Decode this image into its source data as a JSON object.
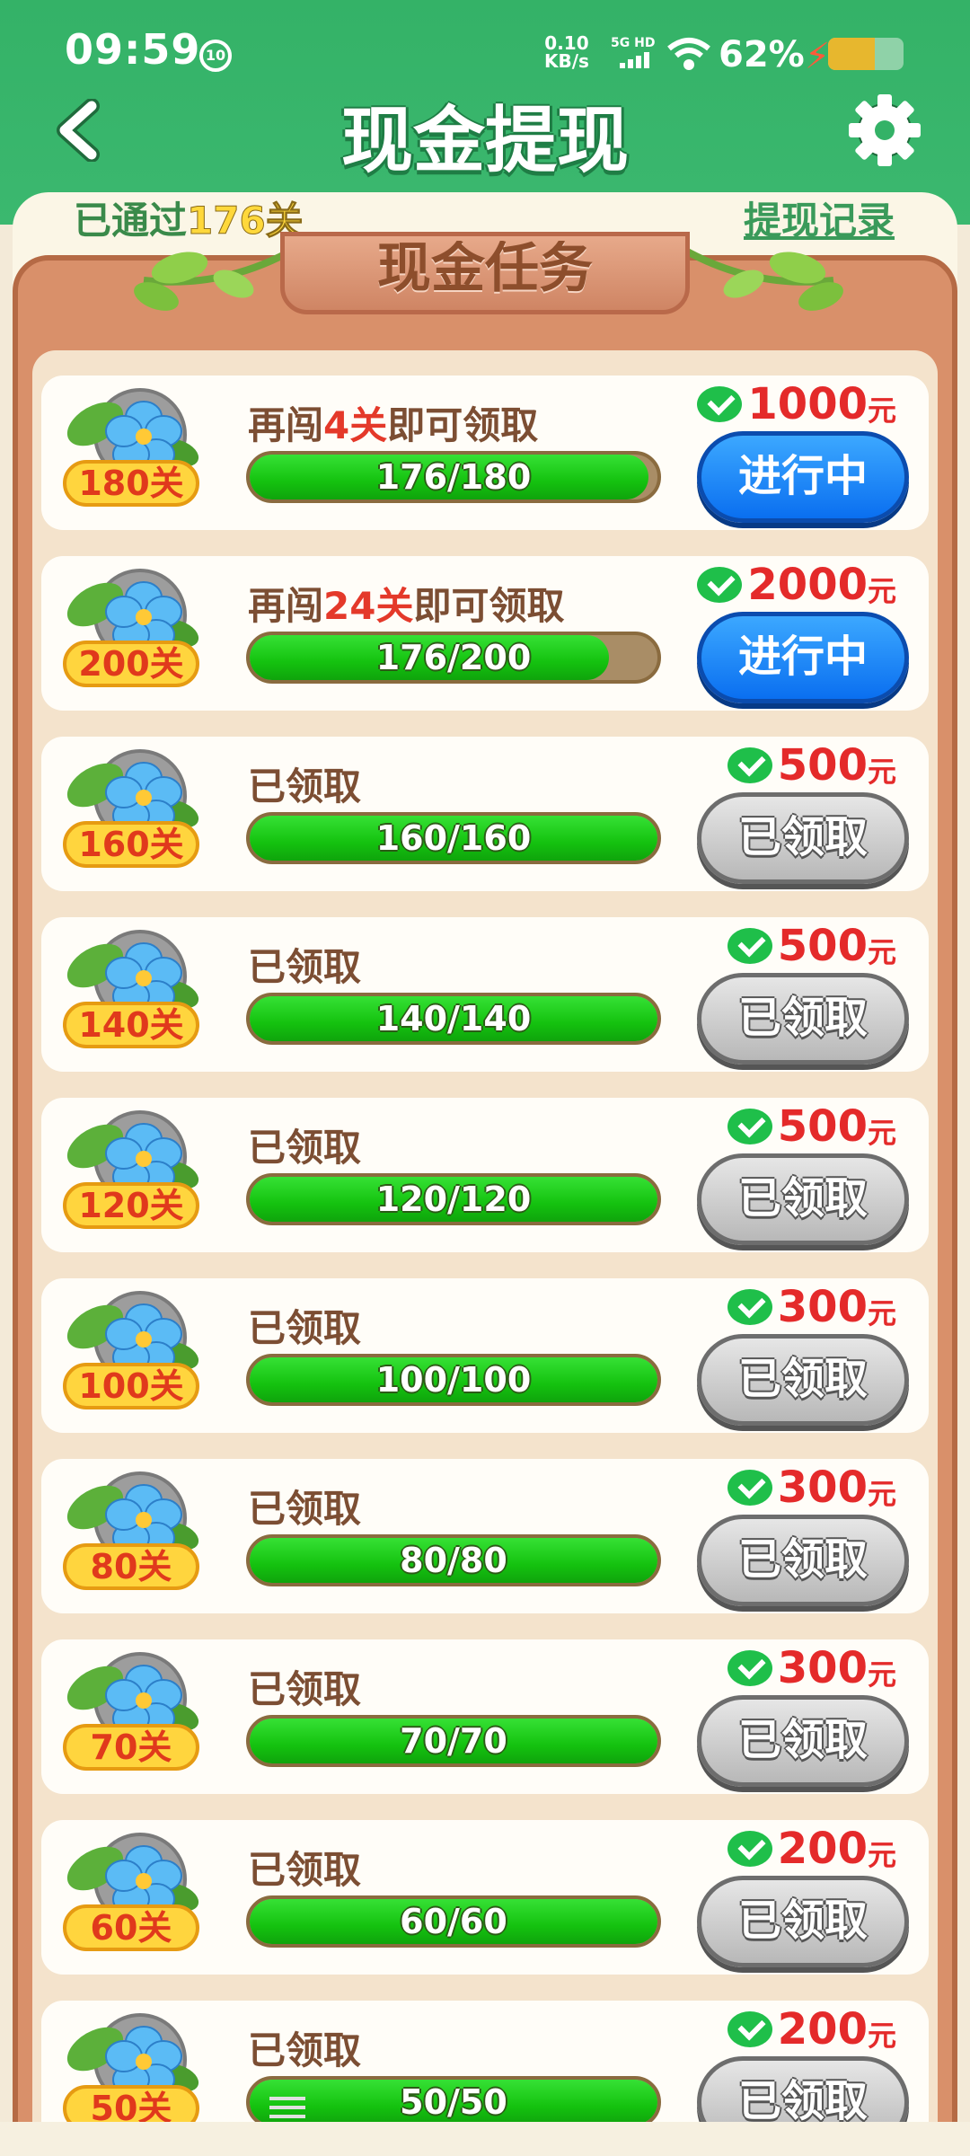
{
  "status_bar": {
    "time": "09:59",
    "notification_badge": "10",
    "net_speed_value": "0.10",
    "net_speed_unit": "KB/s",
    "signal_label": "5G HD",
    "battery_percent": "62%",
    "battery_level": 0.62
  },
  "header": {
    "title": "现金提现"
  },
  "subheader": {
    "passed_prefix": "已通过",
    "passed_count": "176关",
    "withdraw_record": "提现记录"
  },
  "section": {
    "title": "现金任务"
  },
  "colors": {
    "header_green": "#34b267",
    "reward_red": "#e42a2a",
    "progress_green": "#14c20f",
    "active_button_blue": "#0a6ff0",
    "done_button_gray": "#b8b8b8"
  },
  "tasks": [
    {
      "level": "180关",
      "label_pre": "再闯",
      "label_hl": "4关",
      "label_post": "即可领取",
      "progress": "176/180",
      "ratio": 0.978,
      "reward": "1000",
      "unit": "元",
      "button": "进行中",
      "state": "active"
    },
    {
      "level": "200关",
      "label_pre": "再闯",
      "label_hl": "24关",
      "label_post": "即可领取",
      "progress": "176/200",
      "ratio": 0.88,
      "reward": "2000",
      "unit": "元",
      "button": "进行中",
      "state": "active"
    },
    {
      "level": "160关",
      "label_pre": "已领取",
      "label_hl": "",
      "label_post": "",
      "progress": "160/160",
      "ratio": 1,
      "reward": "500",
      "unit": "元",
      "button": "已领取",
      "state": "done"
    },
    {
      "level": "140关",
      "label_pre": "已领取",
      "label_hl": "",
      "label_post": "",
      "progress": "140/140",
      "ratio": 1,
      "reward": "500",
      "unit": "元",
      "button": "已领取",
      "state": "done"
    },
    {
      "level": "120关",
      "label_pre": "已领取",
      "label_hl": "",
      "label_post": "",
      "progress": "120/120",
      "ratio": 1,
      "reward": "500",
      "unit": "元",
      "button": "已领取",
      "state": "done"
    },
    {
      "level": "100关",
      "label_pre": "已领取",
      "label_hl": "",
      "label_post": "",
      "progress": "100/100",
      "ratio": 1,
      "reward": "300",
      "unit": "元",
      "button": "已领取",
      "state": "done"
    },
    {
      "level": "80关",
      "label_pre": "已领取",
      "label_hl": "",
      "label_post": "",
      "progress": "80/80",
      "ratio": 1,
      "reward": "300",
      "unit": "元",
      "button": "已领取",
      "state": "done"
    },
    {
      "level": "70关",
      "label_pre": "已领取",
      "label_hl": "",
      "label_post": "",
      "progress": "70/70",
      "ratio": 1,
      "reward": "300",
      "unit": "元",
      "button": "已领取",
      "state": "done"
    },
    {
      "level": "60关",
      "label_pre": "已领取",
      "label_hl": "",
      "label_post": "",
      "progress": "60/60",
      "ratio": 1,
      "reward": "200",
      "unit": "元",
      "button": "已领取",
      "state": "done"
    },
    {
      "level": "50关",
      "label_pre": "已领取",
      "label_hl": "",
      "label_post": "",
      "progress": "50/50",
      "ratio": 1,
      "reward": "200",
      "unit": "元",
      "button": "已领取",
      "state": "done"
    }
  ]
}
